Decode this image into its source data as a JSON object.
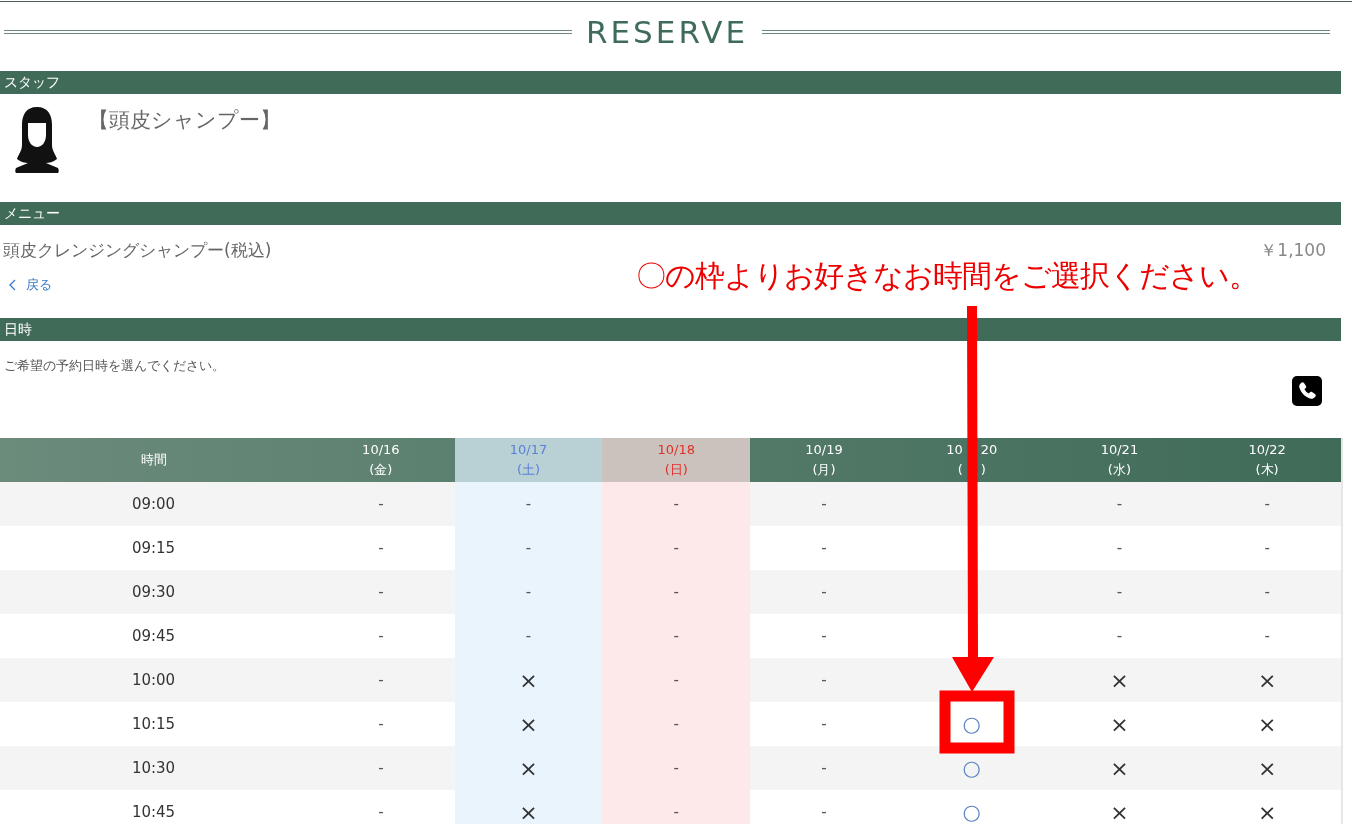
{
  "page_title": "RESERVE",
  "staff": {
    "heading": "スタッフ",
    "name": "【頭皮シャンプー】"
  },
  "menu": {
    "heading": "メニュー",
    "item": "頭皮クレンジングシャンプー(税込)",
    "price": "￥1,100",
    "back_link": "戻る"
  },
  "datetime": {
    "heading": "日時",
    "instruction": "ご希望の予約日時を選んでください。"
  },
  "schedule": {
    "time_header": "時間",
    "days": [
      {
        "date": "10/16",
        "weekday": "(金)",
        "kind": "weekday"
      },
      {
        "date": "10/17",
        "weekday": "(土)",
        "kind": "saturday"
      },
      {
        "date": "10/18",
        "weekday": "(日)",
        "kind": "sunday"
      },
      {
        "date": "10/19",
        "weekday": "(月)",
        "kind": "weekday"
      },
      {
        "date_parts": [
          "10",
          "20"
        ],
        "weekday_parts": [
          "(",
          ")"
        ],
        "kind": "weekday"
      },
      {
        "date": "10/21",
        "weekday": "(水)",
        "kind": "weekday"
      },
      {
        "date": "10/22",
        "weekday": "(木)",
        "kind": "weekday"
      }
    ],
    "rows": [
      {
        "time": "09:00",
        "cells": [
          {
            "kind": "none",
            "text": "-"
          },
          {
            "kind": "none",
            "text": "-"
          },
          {
            "kind": "none",
            "text": "-"
          },
          {
            "kind": "none",
            "text": "-"
          },
          null,
          {
            "kind": "none",
            "text": "-"
          },
          {
            "kind": "none",
            "text": "-"
          }
        ]
      },
      {
        "time": "09:15",
        "cells": [
          {
            "kind": "none",
            "text": "-"
          },
          {
            "kind": "none",
            "text": "-"
          },
          {
            "kind": "none",
            "text": "-"
          },
          {
            "kind": "none",
            "text": "-"
          },
          null,
          {
            "kind": "none",
            "text": "-"
          },
          {
            "kind": "none",
            "text": "-"
          }
        ]
      },
      {
        "time": "09:30",
        "cells": [
          {
            "kind": "none",
            "text": "-"
          },
          {
            "kind": "none",
            "text": "-"
          },
          {
            "kind": "none",
            "text": "-"
          },
          {
            "kind": "none",
            "text": "-"
          },
          null,
          {
            "kind": "none",
            "text": "-"
          },
          {
            "kind": "none",
            "text": "-"
          }
        ]
      },
      {
        "time": "09:45",
        "cells": [
          {
            "kind": "none",
            "text": "-"
          },
          {
            "kind": "none",
            "text": "-"
          },
          {
            "kind": "none",
            "text": "-"
          },
          {
            "kind": "none",
            "text": "-"
          },
          null,
          {
            "kind": "none",
            "text": "-"
          },
          {
            "kind": "none",
            "text": "-"
          }
        ]
      },
      {
        "time": "10:00",
        "cells": [
          {
            "kind": "none",
            "text": "-"
          },
          {
            "kind": "full",
            "text": "×"
          },
          {
            "kind": "none",
            "text": "-"
          },
          {
            "kind": "none",
            "text": "-"
          },
          null,
          {
            "kind": "full",
            "text": "×"
          },
          {
            "kind": "full",
            "text": "×"
          }
        ]
      },
      {
        "time": "10:15",
        "cells": [
          {
            "kind": "none",
            "text": "-"
          },
          {
            "kind": "full",
            "text": "×"
          },
          {
            "kind": "none",
            "text": "-"
          },
          {
            "kind": "none",
            "text": "-"
          },
          {
            "kind": "open",
            "text": "○"
          },
          {
            "kind": "full",
            "text": "×"
          },
          {
            "kind": "full",
            "text": "×"
          }
        ]
      },
      {
        "time": "10:30",
        "cells": [
          {
            "kind": "none",
            "text": "-"
          },
          {
            "kind": "full",
            "text": "×"
          },
          {
            "kind": "none",
            "text": "-"
          },
          {
            "kind": "none",
            "text": "-"
          },
          {
            "kind": "open",
            "text": "○"
          },
          {
            "kind": "full",
            "text": "×"
          },
          {
            "kind": "full",
            "text": "×"
          }
        ]
      },
      {
        "time": "10:45",
        "cells": [
          {
            "kind": "none",
            "text": "-"
          },
          {
            "kind": "full",
            "text": "×"
          },
          {
            "kind": "none",
            "text": "-"
          },
          {
            "kind": "none",
            "text": "-"
          },
          {
            "kind": "open",
            "text": "○"
          },
          {
            "kind": "full",
            "text": "×"
          },
          {
            "kind": "full",
            "text": "×"
          }
        ]
      }
    ]
  },
  "annotation": {
    "text": "〇の枠よりお好きなお時間をご選択ください。"
  }
}
